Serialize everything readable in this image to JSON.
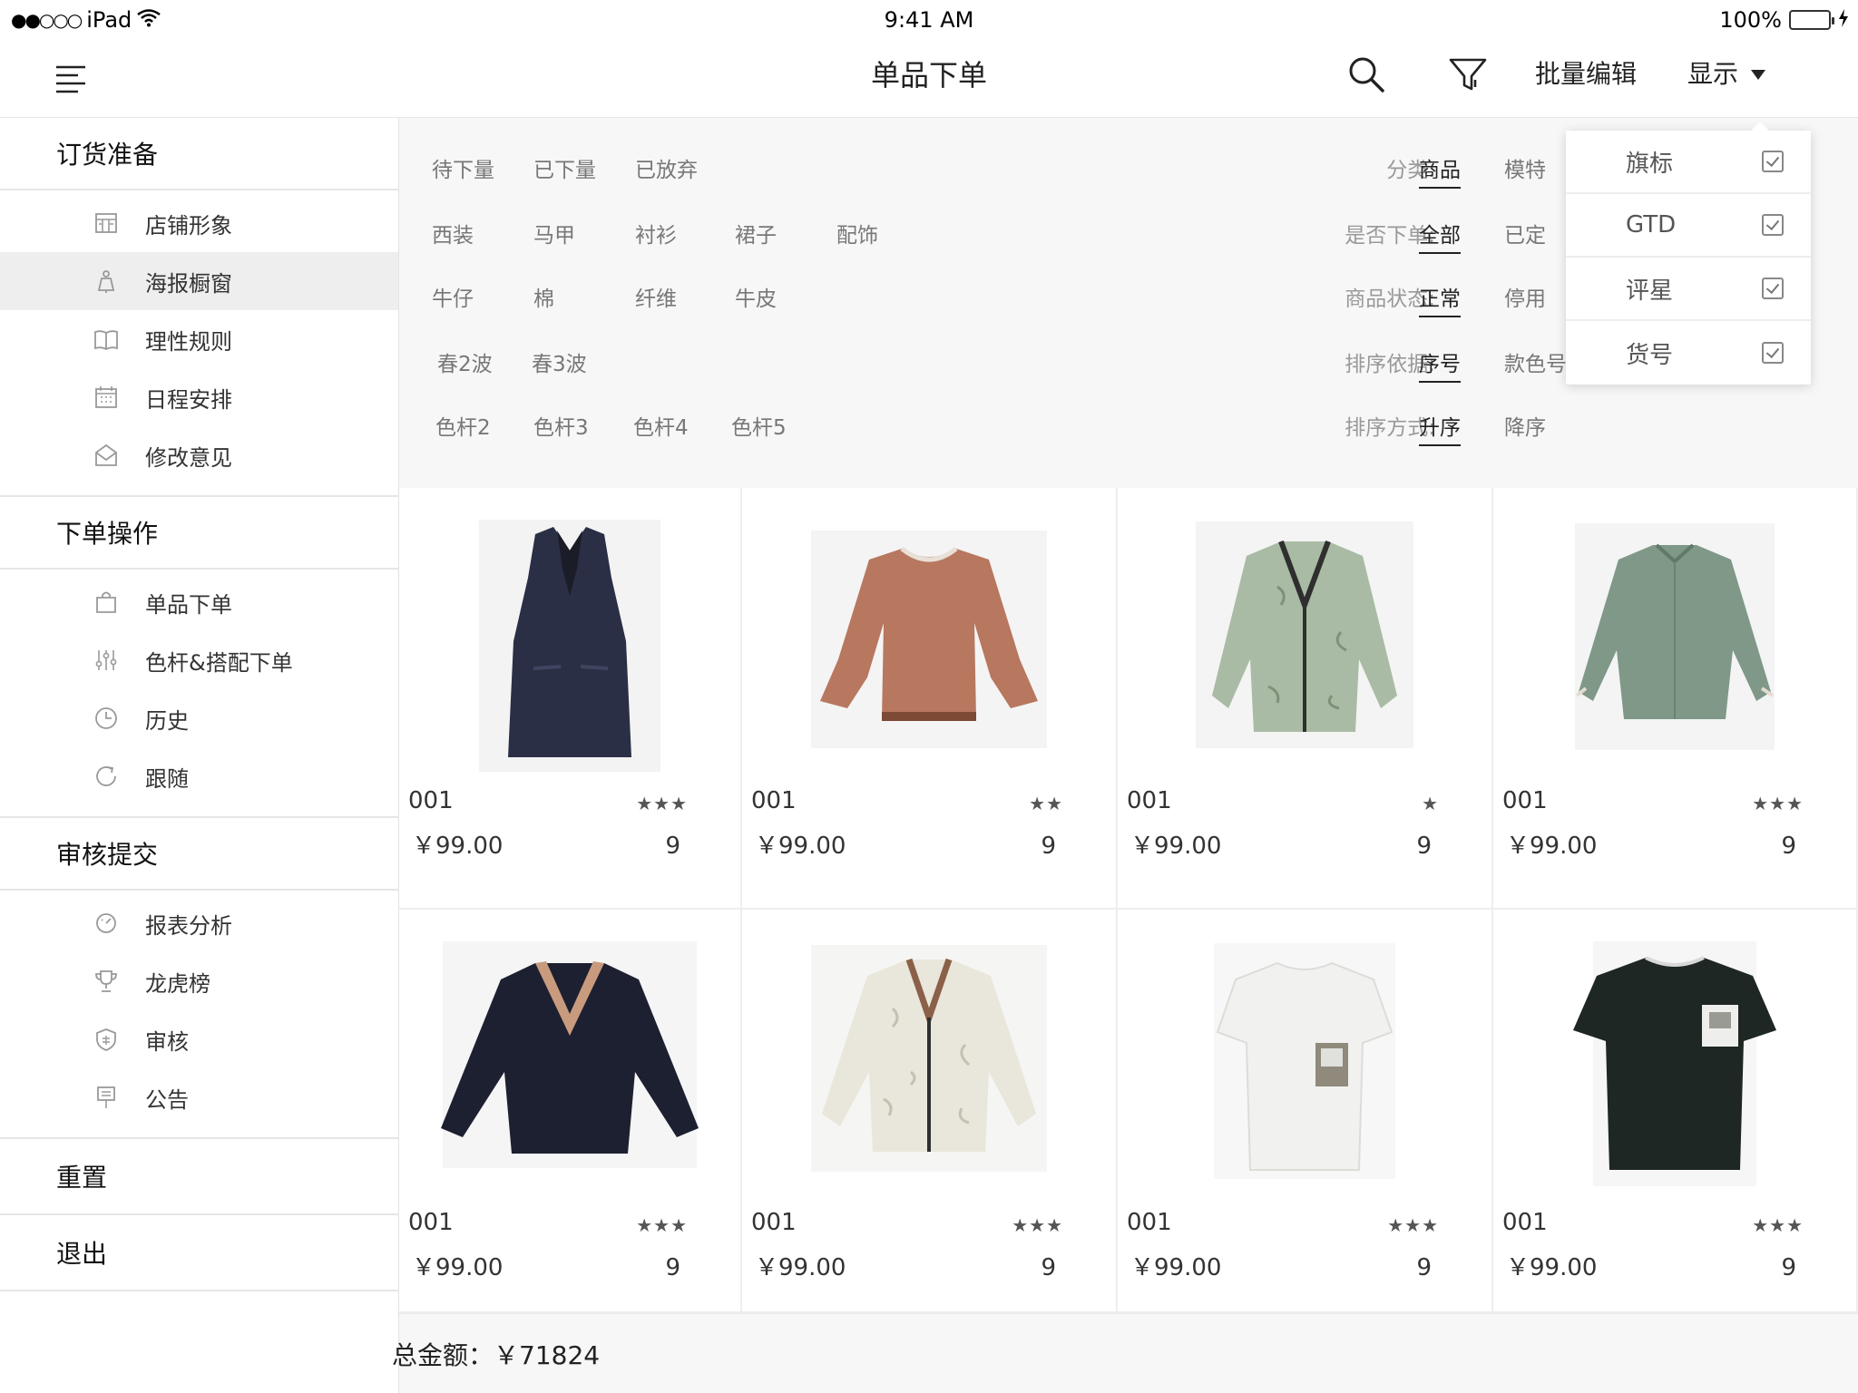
{
  "status_bar": {
    "carrier": "iPad",
    "signal": "●●○○○",
    "time": "9:41 AM",
    "battery": "100%"
  },
  "nav": {
    "title": "单品下单",
    "batch_edit": "批量编辑",
    "display": "显示"
  },
  "sidebar": {
    "sections": [
      {
        "title": "订货准备",
        "items": [
          {
            "label": "店铺形象",
            "icon": "storefront-icon"
          },
          {
            "label": "海报橱窗",
            "icon": "mannequin-icon",
            "active": true
          },
          {
            "label": "理性规则",
            "icon": "book-icon"
          },
          {
            "label": "日程安排",
            "icon": "calendar-icon"
          },
          {
            "label": "修改意见",
            "icon": "mail-icon"
          }
        ]
      },
      {
        "title": "下单操作",
        "items": [
          {
            "label": "单品下单",
            "icon": "shopping-bag-icon"
          },
          {
            "label": "色杆&搭配下单",
            "icon": "sliders-icon"
          },
          {
            "label": "历史",
            "icon": "clock-icon"
          },
          {
            "label": "跟随",
            "icon": "refresh-icon"
          }
        ]
      },
      {
        "title": "审核提交",
        "items": [
          {
            "label": "报表分析",
            "icon": "gauge-icon"
          },
          {
            "label": "龙虎榜",
            "icon": "trophy-icon"
          },
          {
            "label": "审核",
            "icon": "shield-icon"
          },
          {
            "label": "公告",
            "icon": "signpost-icon"
          }
        ]
      }
    ],
    "reset": "重置",
    "logout": "退出"
  },
  "filters": {
    "status_tabs": [
      "待下量",
      "已下量",
      "已放弃"
    ],
    "categories": [
      "西装",
      "马甲",
      "衬衫",
      "裙子",
      "配饰"
    ],
    "materials": [
      "牛仔",
      "棉",
      "纤维",
      "牛皮"
    ],
    "waves": [
      "春2波",
      "春3波"
    ],
    "color_bars": [
      "色杆2",
      "色杆3",
      "色杆4",
      "色杆5"
    ],
    "right_groups": [
      {
        "label": "分类:",
        "selected": "商品",
        "other": "模特"
      },
      {
        "label": "是否下单:",
        "selected": "全部",
        "other": "已定"
      },
      {
        "label": "商品状态:",
        "selected": "正常",
        "other": "停用"
      },
      {
        "label": "排序依据:",
        "selected": "序号",
        "other": "款色号"
      },
      {
        "label": "排序方式:",
        "selected": "升序",
        "other": "降序"
      }
    ]
  },
  "display_dropdown": {
    "options": [
      {
        "label": "旗标",
        "checked": true
      },
      {
        "label": "GTD",
        "checked": true
      },
      {
        "label": "评星",
        "checked": true
      },
      {
        "label": "货号",
        "checked": true
      }
    ]
  },
  "products": [
    {
      "code": "001",
      "price": "￥99.00",
      "stars": "★★★",
      "rating": 3,
      "qty": "9",
      "image": "navy-pinstripe-vest-dress",
      "color": "#2b2f45"
    },
    {
      "code": "001",
      "price": "￥99.00",
      "stars": "★★",
      "rating": 2,
      "qty": "9",
      "image": "rust-bell-sleeve-top",
      "color": "#b8775f"
    },
    {
      "code": "001",
      "price": "￥99.00",
      "stars": "★",
      "rating": 1,
      "qty": "9",
      "image": "sage-print-bomber-jacket",
      "color": "#a9bba4"
    },
    {
      "code": "001",
      "price": "￥99.00",
      "stars": "★★★",
      "rating": 3,
      "qty": "9",
      "image": "sage-green-blouse",
      "color": "#7f9888"
    },
    {
      "code": "001",
      "price": "￥99.00",
      "stars": "★★★",
      "rating": 3,
      "qty": "9",
      "image": "black-v-neck-top",
      "color": "#1d2030"
    },
    {
      "code": "001",
      "price": "￥99.00",
      "stars": "★★★",
      "rating": 3,
      "qty": "9",
      "image": "cream-print-blouse",
      "color": "#e9e6dc"
    },
    {
      "code": "001",
      "price": "￥99.00",
      "stars": "★★★",
      "rating": 3,
      "qty": "9",
      "image": "white-graphic-tee",
      "color": "#f1f1ef"
    },
    {
      "code": "001",
      "price": "￥99.00",
      "stars": "★★★",
      "rating": 3,
      "qty": "9",
      "image": "black-graphic-tee",
      "color": "#1e2723"
    }
  ],
  "footer": {
    "total_text": "总金额：￥71824"
  }
}
